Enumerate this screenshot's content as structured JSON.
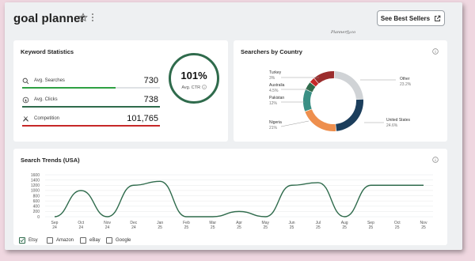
{
  "header": {
    "title": "goal planner",
    "best_sellers_label": "See Best Sellers",
    "watermark": "Plannerfy.co"
  },
  "keyword_stats": {
    "title": "Keyword Statistics",
    "rows": [
      {
        "label": "Avg. Searches",
        "value": "730",
        "fill": 0.68,
        "color": "#2ea043",
        "icon": "search-icon"
      },
      {
        "label": "Avg. Clicks",
        "value": "738",
        "fill": 1.0,
        "color": "#2f6b4c",
        "icon": "click-icon"
      },
      {
        "label": "Competition",
        "value": "101,765",
        "fill": 1.0,
        "color": "#c62828",
        "icon": "competition-icon"
      }
    ],
    "ctr_value": "101%",
    "ctr_label": "Avg. CTR"
  },
  "searchers": {
    "title": "Searchers by Country",
    "slices": [
      {
        "name": "Other",
        "pct": "23.2%",
        "value": 23.2,
        "color": "#d0d3d6"
      },
      {
        "name": "United States",
        "pct": "24.6%",
        "value": 24.6,
        "color": "#1c3e5c"
      },
      {
        "name": "Nigeria",
        "pct": "21%",
        "value": 21,
        "color": "#ee8f4e"
      },
      {
        "name": "Pakistan",
        "pct": "12%",
        "value": 12,
        "color": "#3a8f84"
      },
      {
        "name": "Australia",
        "pct": "4.5%",
        "value": 4.5,
        "color": "#2f6b4c"
      },
      {
        "name": "Turkey",
        "pct": "3%",
        "value": 3,
        "color": "#c62828"
      },
      {
        "name": "",
        "pct": "",
        "value": 11.7,
        "color": "#9b2d2d"
      }
    ]
  },
  "chart_data": {
    "type": "line",
    "title": "Search Trends (USA)",
    "x": [
      "Sep 24",
      "Oct 24",
      "Nov 24",
      "Dec 24",
      "Jan 25",
      "Feb 25",
      "Mar 25",
      "Apr 25",
      "May 25",
      "Jun 25",
      "Jul 25",
      "Aug 25",
      "Sep 25",
      "Oct 25",
      "Nov 25"
    ],
    "series": [
      {
        "name": "Etsy",
        "values": [
          0,
          1000,
          0,
          1200,
          1350,
          0,
          0,
          200,
          0,
          1200,
          1300,
          0,
          1200,
          1200,
          1200
        ]
      }
    ],
    "ylim": [
      0,
      1600
    ],
    "yticks": [
      0,
      200,
      400,
      600,
      800,
      1000,
      1200,
      1400,
      1600
    ],
    "grid": true,
    "color": "#2f6b4c"
  },
  "legend": [
    {
      "label": "Etsy",
      "checked": true
    },
    {
      "label": "Amazon",
      "checked": false
    },
    {
      "label": "eBay",
      "checked": false
    },
    {
      "label": "Google",
      "checked": false
    }
  ]
}
